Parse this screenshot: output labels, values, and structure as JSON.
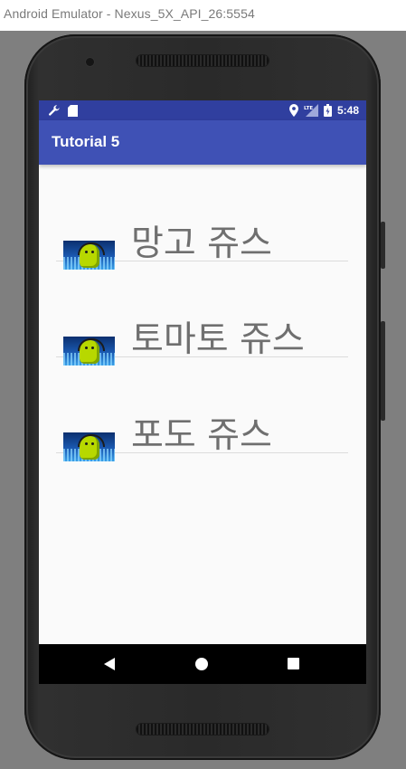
{
  "window": {
    "title": "Android Emulator - Nexus_5X_API_26:5554"
  },
  "status_bar": {
    "time": "5:48",
    "network": "LTE",
    "left_icons": [
      "wrench-icon",
      "sd-card-icon"
    ],
    "right_icons": [
      "location-icon",
      "lte-signal-icon",
      "battery-charging-icon"
    ]
  },
  "app_bar": {
    "title": "Tutorial 5"
  },
  "list": {
    "items": [
      {
        "label": "망고 쥬스",
        "image": "android-thumbnail"
      },
      {
        "label": "토마토 쥬스",
        "image": "android-thumbnail"
      },
      {
        "label": "포도 쥬스",
        "image": "android-thumbnail"
      }
    ]
  },
  "nav_bar": {
    "buttons": [
      "back",
      "home",
      "recents"
    ]
  },
  "colors": {
    "status_bar": "#303f9f",
    "app_bar": "#3f51b5",
    "list_text": "#6f6f6f",
    "background": "#fafafa"
  }
}
